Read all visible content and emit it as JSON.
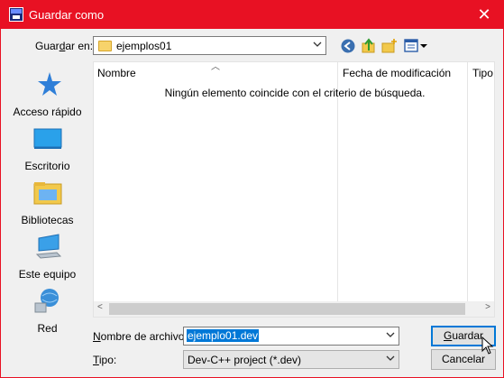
{
  "window": {
    "title": "Guardar como",
    "close_glyph": "✕"
  },
  "location": {
    "label_prefix": "Guar",
    "label_accel": "d",
    "label_suffix": "ar en:",
    "folder_name": "ejemplos01"
  },
  "toolbar": {
    "icons": [
      "back-icon",
      "up-folder-icon",
      "new-folder-icon",
      "view-menu-icon"
    ]
  },
  "places": [
    {
      "name": "quick-access",
      "label": "Acceso rápido",
      "icon": "star-icon"
    },
    {
      "name": "desktop",
      "label": "Escritorio",
      "icon": "desktop-icon"
    },
    {
      "name": "libraries",
      "label": "Bibliotecas",
      "icon": "libraries-icon"
    },
    {
      "name": "this-pc",
      "label": "Este equipo",
      "icon": "computer-icon"
    },
    {
      "name": "network",
      "label": "Red",
      "icon": "network-icon"
    }
  ],
  "file_list": {
    "columns": [
      "Nombre",
      "Fecha de modificación",
      "Tipo"
    ],
    "empty_message": "Ningún elemento coincide con el criterio de búsqueda."
  },
  "filename": {
    "label_prefix": "",
    "label_accel": "N",
    "label_suffix": "ombre de archivo:",
    "value": "ejemplo01.dev"
  },
  "filetype": {
    "label_prefix": "",
    "label_accel": "T",
    "label_suffix": "ipo:",
    "value": "Dev-C++ project (*.dev)"
  },
  "buttons": {
    "save_accel": "G",
    "save_rest": "uardar",
    "cancel": "Cancelar"
  },
  "colors": {
    "titlebar": "#e81123",
    "accent": "#0078d7"
  }
}
